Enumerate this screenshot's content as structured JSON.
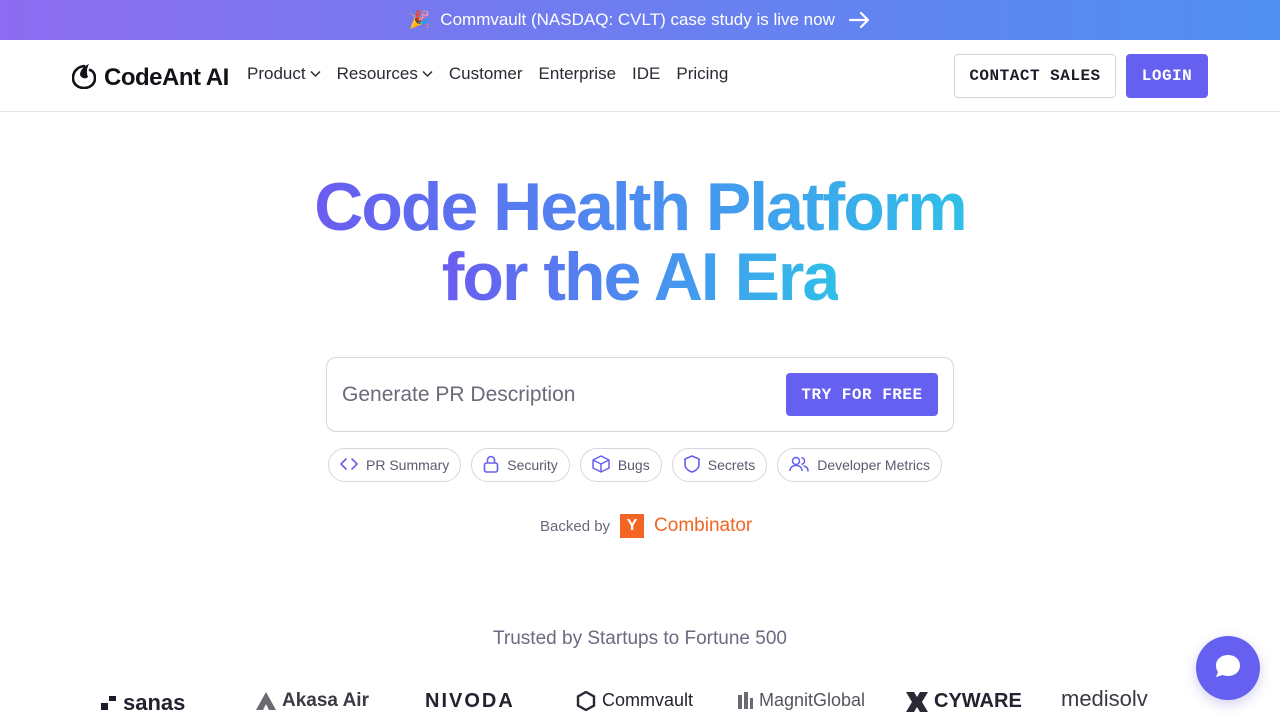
{
  "announcement": {
    "emoji": "🎉",
    "text": "Commvault (NASDAQ: CVLT) case study is live now"
  },
  "brand": {
    "name": "CodeAnt AI"
  },
  "nav": {
    "items": [
      {
        "label": "Product",
        "has_dropdown": true
      },
      {
        "label": "Resources",
        "has_dropdown": true
      },
      {
        "label": "Customer",
        "has_dropdown": false
      },
      {
        "label": "Enterprise",
        "has_dropdown": false
      },
      {
        "label": "IDE",
        "has_dropdown": false
      },
      {
        "label": "Pricing",
        "has_dropdown": false
      }
    ],
    "contact_label": "CONTACT SALES",
    "login_label": "LOGIN"
  },
  "hero": {
    "line1": "Code Health Platform",
    "line2": "for the AI Era"
  },
  "prompt": {
    "placeholder": "Generate PR Description",
    "button_label": "TRY FOR FREE"
  },
  "chips": [
    {
      "label": "PR Summary",
      "icon": "code-icon"
    },
    {
      "label": "Security",
      "icon": "lock-icon"
    },
    {
      "label": "Bugs",
      "icon": "bug-cube-icon"
    },
    {
      "label": "Secrets",
      "icon": "shield-icon"
    },
    {
      "label": "Developer Metrics",
      "icon": "users-icon"
    }
  ],
  "backed": {
    "label": "Backed by",
    "yc_letter": "Y",
    "yc_name": "Combinator"
  },
  "trusted": {
    "text": "Trusted by Startups to Fortune 500"
  },
  "customer_logos": [
    "sanas",
    "Akasa Air",
    "NIVODA",
    "Commvault",
    "MagnitGlobal",
    "CYWARE",
    "medisolv"
  ],
  "colors": {
    "accent": "#6660f0",
    "gradient_start": "#6a5cf0",
    "gradient_end": "#2fc0e8",
    "yc_orange": "#f26522"
  }
}
